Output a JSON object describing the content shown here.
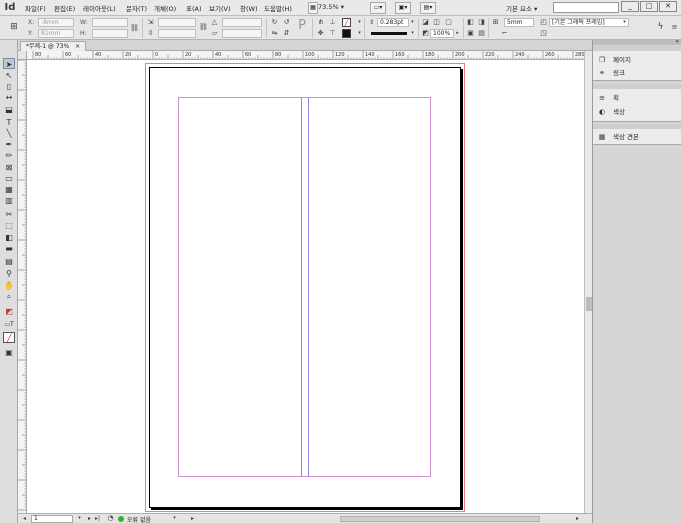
{
  "menubar": {
    "logo": "Id",
    "items": [
      "파일(F)",
      "편집(E)",
      "레이아웃(L)",
      "문자(T)",
      "개체(O)",
      "표(A)",
      "보기(V)",
      "창(W)",
      "도움말(H)"
    ],
    "zoom": "73.5%",
    "workspace": "기본 요소",
    "window_buttons": [
      "_",
      "□",
      "✕"
    ]
  },
  "controlbar": {
    "x_label": "X:",
    "x_value": "-8mm",
    "y_label": "Y:",
    "y_value": "81mm",
    "w_label": "W:",
    "h_label": "H:",
    "stroke_weight": "0.283pt",
    "opacity": "100%",
    "gap": "5mm",
    "object_style": "[기본 그래픽 프레임]"
  },
  "document": {
    "tab_label": "*무제-1 @ 73%",
    "tab_close": "×"
  },
  "ruler": {
    "h_labels": [
      "80",
      "60",
      "40",
      "20",
      "0",
      "20",
      "40",
      "60",
      "80",
      "100",
      "120",
      "140",
      "160",
      "180",
      "200",
      "220",
      "240",
      "260",
      "280"
    ]
  },
  "status": {
    "page": "1",
    "preflight": "오류 없음"
  },
  "panels": {
    "group1": [
      {
        "icon": "pages-icon",
        "label": "페이지"
      },
      {
        "icon": "links-icon",
        "label": "링크"
      }
    ],
    "group2": [
      {
        "icon": "stroke-icon",
        "label": "획"
      },
      {
        "icon": "color-icon",
        "label": "색상"
      }
    ],
    "group3": [
      {
        "icon": "swatches-icon",
        "label": "색상 견본"
      }
    ]
  },
  "colors": {
    "bleed": "#f08080",
    "margin": "#d08fd0",
    "column_guide": "#8a8ae8"
  }
}
